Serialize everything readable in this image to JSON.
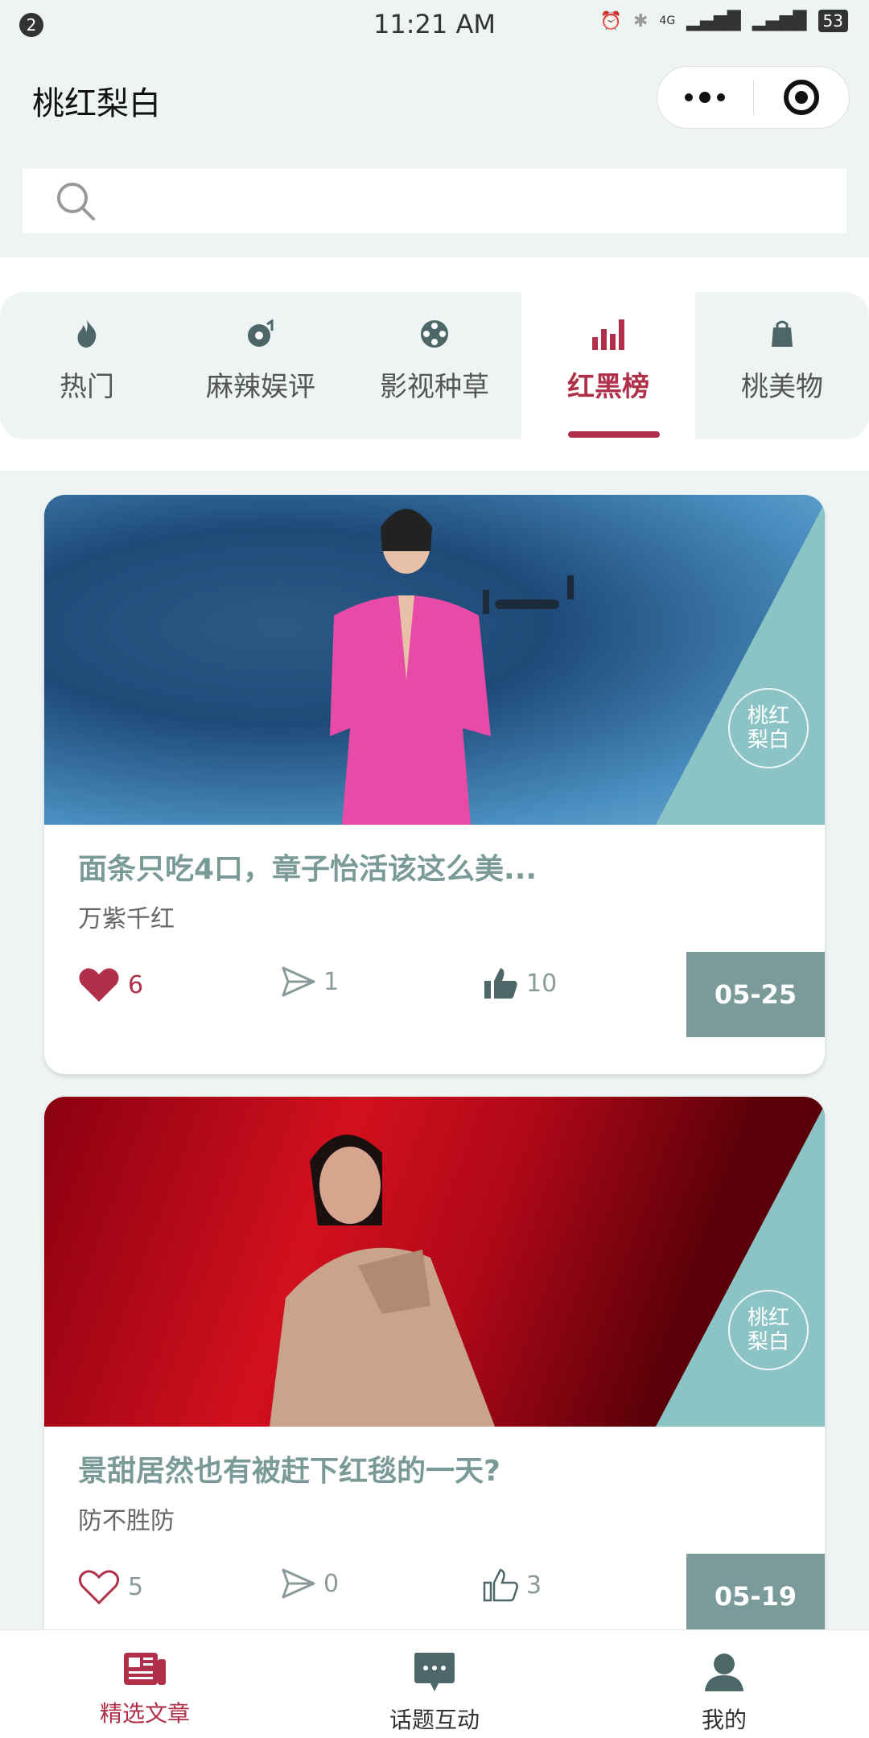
{
  "status_bar": {
    "notif_count": "2",
    "time": "11:21 AM",
    "network": "4G",
    "battery": "53"
  },
  "navbar": {
    "title": "桃红梨白"
  },
  "search": {
    "placeholder": ""
  },
  "tabs": [
    {
      "label": "热门",
      "icon": "flame-icon"
    },
    {
      "label": "麻辣娱评",
      "icon": "music-disc-icon"
    },
    {
      "label": "影视种草",
      "icon": "film-reel-icon"
    },
    {
      "label": "红黑榜",
      "icon": "bar-chart-icon",
      "active": true
    },
    {
      "label": "桃美物",
      "icon": "shopping-bag-icon"
    }
  ],
  "articles": [
    {
      "title": "面条只吃4口，章子怡活该这么美...",
      "author": "万紫千红",
      "likes": "6",
      "shares": "1",
      "thumbs": "10",
      "date": "05-25",
      "liked": true,
      "thumbed": true
    },
    {
      "title": "景甜居然也有被赶下红毯的一天?",
      "author": "防不胜防",
      "likes": "5",
      "shares": "0",
      "thumbs": "3",
      "date": "05-19",
      "liked": false,
      "thumbed": false
    }
  ],
  "watermark": "桃红梨白",
  "bottom_nav": [
    {
      "label": "精选文章",
      "icon": "news-icon",
      "active": true
    },
    {
      "label": "话题互动",
      "icon": "chat-icon"
    },
    {
      "label": "我的",
      "icon": "user-icon"
    }
  ],
  "colors": {
    "accent": "#b0304a",
    "teal": "#7b9a9a",
    "bg": "#eef4f3"
  }
}
